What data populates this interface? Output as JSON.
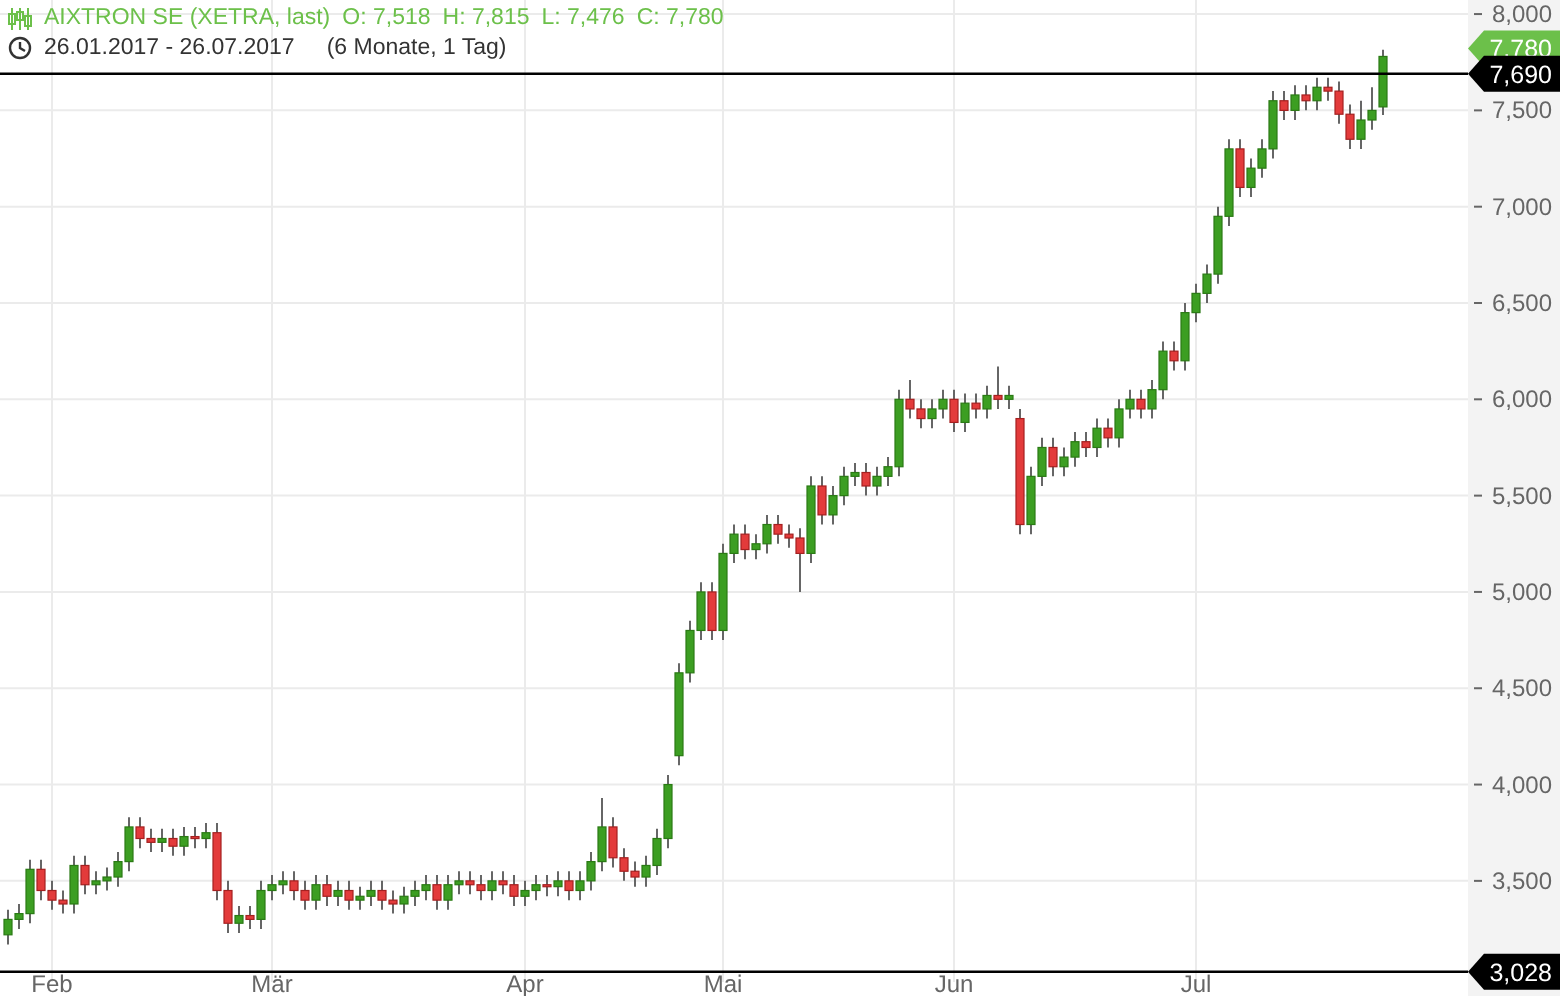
{
  "legend": {
    "name": "AIXTRON SE (XETRA, last)",
    "values": [
      "O: 7,518",
      "H: 7,815",
      "L: 7,476",
      "C: 7,780"
    ],
    "range": "26.01.2017 - 26.07.2017",
    "period": "(6 Monate, 1 Tag)"
  },
  "chart_data": {
    "type": "candlestick",
    "ylim": [
      2975,
      8073
    ],
    "categories": [
      null,
      null,
      null,
      null,
      "Feb",
      null,
      null,
      null,
      null,
      null,
      null,
      null,
      null,
      null,
      null,
      null,
      null,
      null,
      null,
      null,
      null,
      null,
      null,
      null,
      "Mär",
      null,
      null,
      null,
      null,
      null,
      null,
      null,
      null,
      null,
      null,
      null,
      null,
      null,
      null,
      null,
      null,
      null,
      null,
      null,
      null,
      null,
      null,
      "Apr",
      null,
      null,
      null,
      null,
      null,
      null,
      null,
      null,
      null,
      null,
      null,
      null,
      null,
      null,
      null,
      null,
      null,
      "Mai",
      null,
      null,
      null,
      null,
      null,
      null,
      null,
      null,
      null,
      null,
      null,
      null,
      null,
      null,
      null,
      null,
      null,
      null,
      null,
      null,
      "Jun",
      null,
      null,
      null,
      null,
      null,
      null,
      null,
      null,
      null,
      null,
      null,
      null,
      null,
      null,
      null,
      null,
      null,
      null,
      null,
      null,
      null,
      "Jul",
      null,
      null,
      null,
      null,
      null,
      null,
      null,
      null,
      null,
      null,
      null,
      null,
      null,
      null,
      null,
      null,
      null
    ],
    "yticks": [
      {
        "value": 3500,
        "label": "3,500"
      },
      {
        "value": 4000,
        "label": "4,000"
      },
      {
        "value": 4500,
        "label": "4,500"
      },
      {
        "value": 5000,
        "label": "5,000"
      },
      {
        "value": 5500,
        "label": "5,500"
      },
      {
        "value": 6000,
        "label": "6,000"
      },
      {
        "value": 6500,
        "label": "6,500"
      },
      {
        "value": 7000,
        "label": "7,000"
      },
      {
        "value": 7500,
        "label": "7,500"
      },
      {
        "value": 8000,
        "label": "8,000"
      }
    ],
    "ohlc": [
      [
        3220,
        3350,
        3170,
        3300
      ],
      [
        3300,
        3380,
        3250,
        3330
      ],
      [
        3330,
        3610,
        3280,
        3560
      ],
      [
        3560,
        3610,
        3400,
        3450
      ],
      [
        3450,
        3500,
        3350,
        3400
      ],
      [
        3400,
        3450,
        3330,
        3380
      ],
      [
        3380,
        3630,
        3330,
        3580
      ],
      [
        3580,
        3630,
        3430,
        3480
      ],
      [
        3480,
        3550,
        3430,
        3500
      ],
      [
        3500,
        3570,
        3450,
        3520
      ],
      [
        3520,
        3650,
        3470,
        3600
      ],
      [
        3600,
        3830,
        3550,
        3780
      ],
      [
        3780,
        3830,
        3670,
        3720
      ],
      [
        3720,
        3770,
        3650,
        3700
      ],
      [
        3700,
        3770,
        3650,
        3720
      ],
      [
        3720,
        3770,
        3630,
        3680
      ],
      [
        3680,
        3780,
        3630,
        3730
      ],
      [
        3730,
        3780,
        3670,
        3720
      ],
      [
        3720,
        3800,
        3670,
        3750
      ],
      [
        3750,
        3800,
        3400,
        3450
      ],
      [
        3450,
        3500,
        3230,
        3280
      ],
      [
        3280,
        3370,
        3230,
        3320
      ],
      [
        3320,
        3370,
        3250,
        3300
      ],
      [
        3300,
        3500,
        3250,
        3450
      ],
      [
        3450,
        3530,
        3400,
        3480
      ],
      [
        3480,
        3550,
        3430,
        3500
      ],
      [
        3500,
        3550,
        3400,
        3450
      ],
      [
        3450,
        3500,
        3350,
        3400
      ],
      [
        3400,
        3530,
        3350,
        3480
      ],
      [
        3480,
        3530,
        3370,
        3420
      ],
      [
        3420,
        3500,
        3370,
        3450
      ],
      [
        3450,
        3500,
        3350,
        3400
      ],
      [
        3400,
        3470,
        3350,
        3420
      ],
      [
        3420,
        3500,
        3370,
        3450
      ],
      [
        3450,
        3500,
        3350,
        3400
      ],
      [
        3400,
        3450,
        3330,
        3380
      ],
      [
        3380,
        3470,
        3330,
        3420
      ],
      [
        3420,
        3500,
        3370,
        3450
      ],
      [
        3450,
        3530,
        3400,
        3480
      ],
      [
        3480,
        3530,
        3350,
        3400
      ],
      [
        3400,
        3530,
        3350,
        3480
      ],
      [
        3480,
        3550,
        3430,
        3500
      ],
      [
        3500,
        3550,
        3430,
        3480
      ],
      [
        3480,
        3530,
        3400,
        3450
      ],
      [
        3450,
        3550,
        3400,
        3500
      ],
      [
        3500,
        3550,
        3430,
        3480
      ],
      [
        3480,
        3530,
        3370,
        3420
      ],
      [
        3420,
        3500,
        3370,
        3450
      ],
      [
        3450,
        3530,
        3400,
        3480
      ],
      [
        3480,
        3530,
        3420,
        3470
      ],
      [
        3470,
        3550,
        3420,
        3500
      ],
      [
        3500,
        3550,
        3400,
        3450
      ],
      [
        3450,
        3550,
        3400,
        3500
      ],
      [
        3500,
        3650,
        3450,
        3600
      ],
      [
        3600,
        3930,
        3550,
        3780
      ],
      [
        3780,
        3830,
        3570,
        3620
      ],
      [
        3620,
        3670,
        3500,
        3550
      ],
      [
        3550,
        3600,
        3470,
        3520
      ],
      [
        3520,
        3630,
        3470,
        3580
      ],
      [
        3580,
        3770,
        3530,
        3720
      ],
      [
        3720,
        4050,
        3670,
        4000
      ],
      [
        4150,
        4630,
        4100,
        4580
      ],
      [
        4580,
        4850,
        4530,
        4800
      ],
      [
        4800,
        5050,
        4750,
        5000
      ],
      [
        5000,
        5050,
        4750,
        4800
      ],
      [
        4800,
        5250,
        4750,
        5200
      ],
      [
        5200,
        5350,
        5150,
        5300
      ],
      [
        5300,
        5350,
        5170,
        5220
      ],
      [
        5220,
        5300,
        5170,
        5250
      ],
      [
        5250,
        5400,
        5200,
        5350
      ],
      [
        5350,
        5400,
        5250,
        5300
      ],
      [
        5300,
        5350,
        5230,
        5280
      ],
      [
        5280,
        5330,
        5000,
        5200
      ],
      [
        5200,
        5600,
        5150,
        5550
      ],
      [
        5550,
        5600,
        5350,
        5400
      ],
      [
        5400,
        5550,
        5350,
        5500
      ],
      [
        5500,
        5650,
        5450,
        5600
      ],
      [
        5600,
        5670,
        5550,
        5620
      ],
      [
        5620,
        5670,
        5500,
        5550
      ],
      [
        5550,
        5650,
        5500,
        5600
      ],
      [
        5600,
        5700,
        5550,
        5650
      ],
      [
        5650,
        6050,
        5600,
        6000
      ],
      [
        6000,
        6100,
        5900,
        5950
      ],
      [
        5950,
        6000,
        5850,
        5900
      ],
      [
        5900,
        6000,
        5850,
        5950
      ],
      [
        5950,
        6050,
        5900,
        6000
      ],
      [
        6000,
        6050,
        5830,
        5880
      ],
      [
        5880,
        6030,
        5830,
        5980
      ],
      [
        5980,
        6030,
        5900,
        5950
      ],
      [
        5950,
        6070,
        5900,
        6020
      ],
      [
        6020,
        6170,
        5950,
        6000
      ],
      [
        6000,
        6070,
        5950,
        6020
      ],
      [
        5900,
        5950,
        5300,
        5350
      ],
      [
        5350,
        5650,
        5300,
        5600
      ],
      [
        5600,
        5800,
        5550,
        5750
      ],
      [
        5750,
        5800,
        5600,
        5650
      ],
      [
        5650,
        5750,
        5600,
        5700
      ],
      [
        5700,
        5830,
        5650,
        5780
      ],
      [
        5780,
        5830,
        5700,
        5750
      ],
      [
        5750,
        5900,
        5700,
        5850
      ],
      [
        5850,
        5900,
        5750,
        5800
      ],
      [
        5800,
        6000,
        5750,
        5950
      ],
      [
        5950,
        6050,
        5900,
        6000
      ],
      [
        6000,
        6050,
        5900,
        5950
      ],
      [
        5950,
        6100,
        5900,
        6050
      ],
      [
        6050,
        6300,
        6000,
        6250
      ],
      [
        6250,
        6300,
        6150,
        6200
      ],
      [
        6200,
        6500,
        6150,
        6450
      ],
      [
        6450,
        6600,
        6400,
        6550
      ],
      [
        6550,
        6700,
        6500,
        6650
      ],
      [
        6650,
        7000,
        6600,
        6950
      ],
      [
        6950,
        7350,
        6900,
        7300
      ],
      [
        7300,
        7350,
        7050,
        7100
      ],
      [
        7100,
        7250,
        7050,
        7200
      ],
      [
        7200,
        7350,
        7150,
        7300
      ],
      [
        7300,
        7600,
        7250,
        7550
      ],
      [
        7550,
        7600,
        7450,
        7500
      ],
      [
        7500,
        7630,
        7450,
        7580
      ],
      [
        7580,
        7630,
        7500,
        7550
      ],
      [
        7550,
        7670,
        7500,
        7620
      ],
      [
        7620,
        7670,
        7550,
        7600
      ],
      [
        7600,
        7650,
        7430,
        7480
      ],
      [
        7480,
        7530,
        7300,
        7350
      ],
      [
        7350,
        7550,
        7300,
        7450
      ],
      [
        7450,
        7620,
        7400,
        7500
      ],
      [
        7518,
        7815,
        7476,
        7780
      ]
    ],
    "grid": true,
    "ref_lines": [
      {
        "axis": "y",
        "value": 7690,
        "label": "7,690"
      },
      {
        "axis": "y",
        "value": 3028,
        "label": "3,028"
      }
    ]
  },
  "last_tag": {
    "label": "7,780"
  }
}
